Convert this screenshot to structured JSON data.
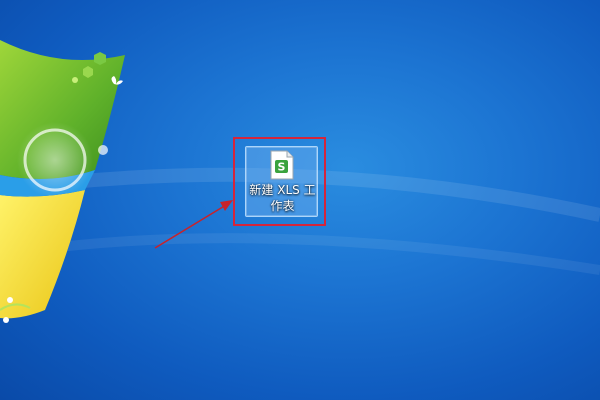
{
  "desktop": {
    "background_color": "#1c74d2",
    "wallpaper": "windows-7-logo-wallpaper"
  },
  "file_icon": {
    "icon": "spreadsheet-file-icon",
    "glyph_letter": "S",
    "glyph_color": "#3aa33d",
    "label_line1": "新建 XLS 工",
    "label_line2": "作表",
    "selected": true
  },
  "annotation": {
    "box_color": "#d5253b",
    "arrow_color": "#c8232b"
  }
}
